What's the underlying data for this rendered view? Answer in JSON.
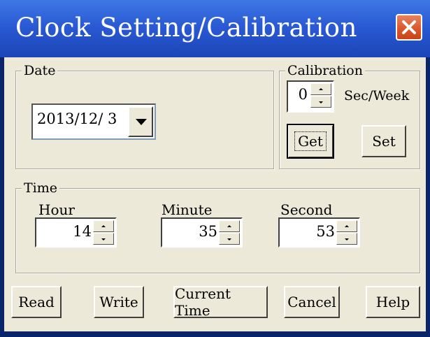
{
  "window": {
    "title": "Clock Setting/Calibration"
  },
  "date_group": {
    "label": "Date",
    "value": "2013/12/  3"
  },
  "calibration_group": {
    "label": "Calibration",
    "value": "0",
    "unit": "Sec/Week",
    "get_label": "Get",
    "set_label": "Set"
  },
  "time_group": {
    "label": "Time",
    "hour_label": "Hour",
    "hour_value": "14",
    "minute_label": "Minute",
    "minute_value": "35",
    "second_label": "Second",
    "second_value": "53"
  },
  "buttons": {
    "read": "Read",
    "write": "Write",
    "current_time": "Current Time",
    "cancel": "Cancel",
    "help": "Help"
  },
  "icons": {
    "close": "close-icon",
    "dropdown": "chevron-down-icon"
  },
  "colors": {
    "titlebar": "#2a5ad4",
    "close": "#d9552a",
    "face": "#ece9d8"
  }
}
